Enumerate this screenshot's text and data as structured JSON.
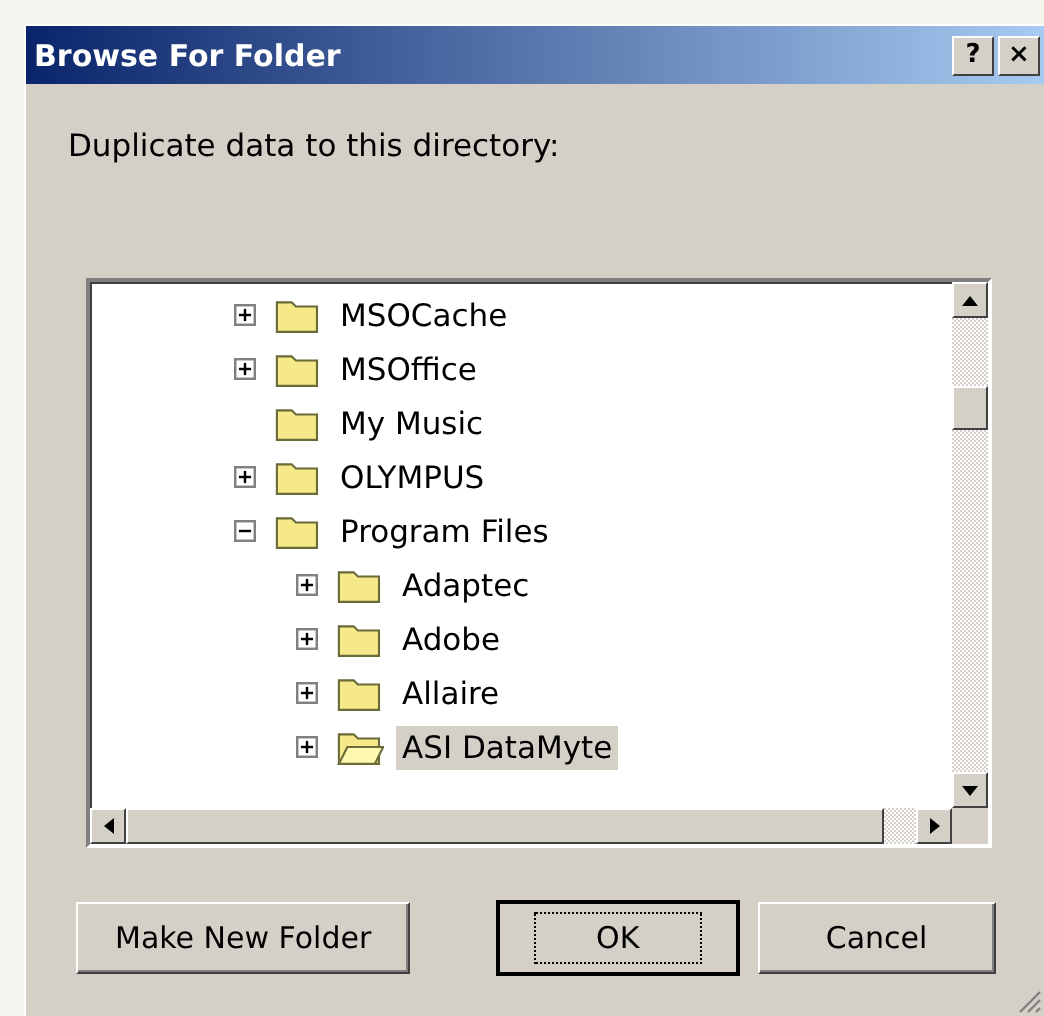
{
  "window": {
    "title": "Browse For Folder",
    "controls": [
      "?",
      "×"
    ]
  },
  "prompt": "Duplicate data to this directory:",
  "tree": [
    {
      "label": "MSOCache",
      "expanded": false,
      "selected": false
    },
    {
      "label": "MSOffice",
      "expanded": false,
      "selected": false
    },
    {
      "label": "My Music",
      "selected": false
    },
    {
      "label": "OLYMPUS",
      "expanded": false,
      "selected": false
    },
    {
      "label": "Program Files",
      "expanded": true,
      "selected": false,
      "children": [
        {
          "label": "Adaptec",
          "expanded": false,
          "selected": false
        },
        {
          "label": "Adobe",
          "expanded": false,
          "selected": false
        },
        {
          "label": "Allaire",
          "expanded": false,
          "selected": false
        },
        {
          "label": "ASI DataMyte",
          "expanded": false,
          "selected": true
        }
      ]
    }
  ],
  "buttons": [
    {
      "label": "Make New Folder",
      "default": false
    },
    {
      "label": "OK",
      "default": true
    },
    {
      "label": "Cancel",
      "default": false
    }
  ]
}
